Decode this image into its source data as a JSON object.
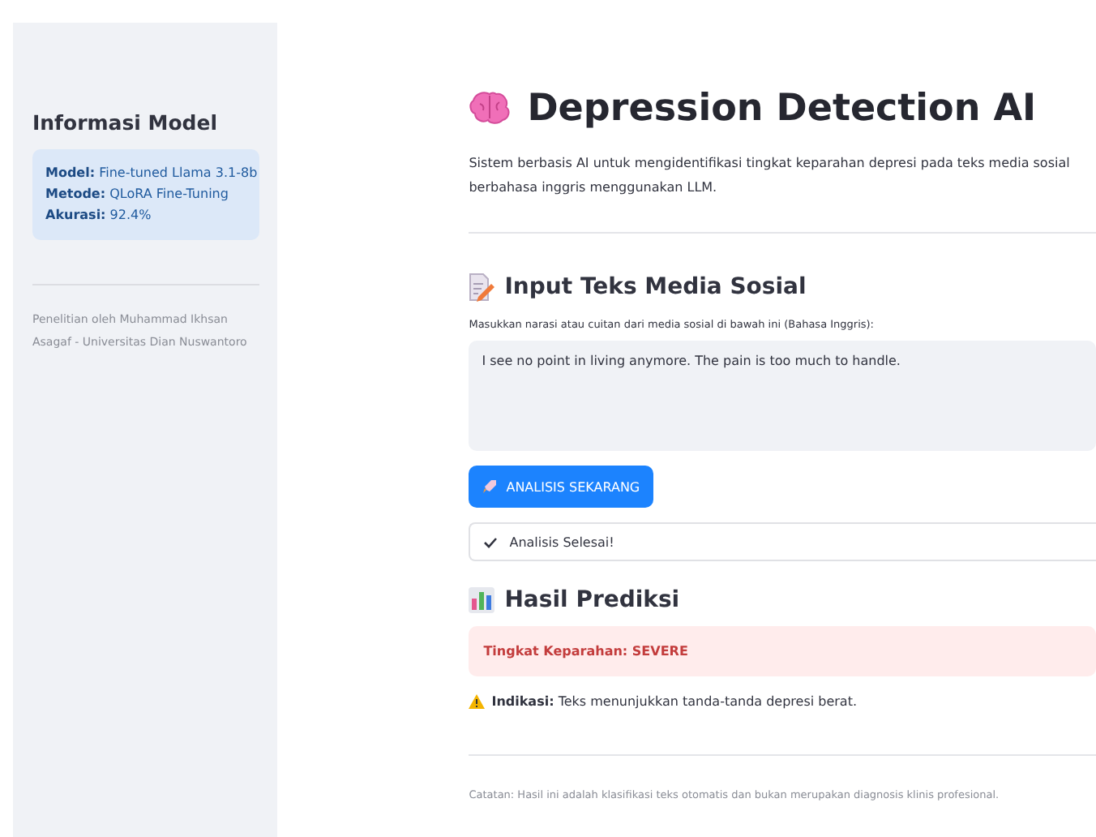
{
  "sidebar": {
    "title": "Informasi Model",
    "info": [
      {
        "label": "Model:",
        "value": "Fine-tuned Llama 3.1-8b"
      },
      {
        "label": "Metode:",
        "value": "QLoRA Fine-Tuning"
      },
      {
        "label": "Akurasi:",
        "value": "92.4%"
      }
    ],
    "credit": "Penelitian oleh Muhammad Ikhsan Asagaf - Universitas Dian Nuswantoro"
  },
  "main": {
    "title": "Depression Detection AI",
    "description": "Sistem berbasis AI untuk mengidentifikasi tingkat keparahan depresi pada teks media sosial berbahasa inggris menggunakan LLM.",
    "input_section": {
      "heading": "Input Teks Media Sosial",
      "field_label": "Masukkan narasi atau cuitan dari media sosial di bawah ini (Bahasa Inggris):",
      "value": "I see no point in living anymore. The pain is too much to handle."
    },
    "button": {
      "label": "ANALISIS SEKARANG"
    },
    "status": {
      "text": "Analisis Selesai!"
    },
    "results": {
      "heading": "Hasil Prediksi",
      "alert": {
        "kind": "error",
        "text": "Tingkat Keparahan: SEVERE"
      },
      "indication": {
        "label": "Indikasi:",
        "text": "Teks menunjukkan tanda-tanda depresi berat."
      }
    },
    "note": "Catatan: Hasil ini adalah klasifikasi teks otomatis dan bukan merupakan diagnosis klinis profesional."
  }
}
